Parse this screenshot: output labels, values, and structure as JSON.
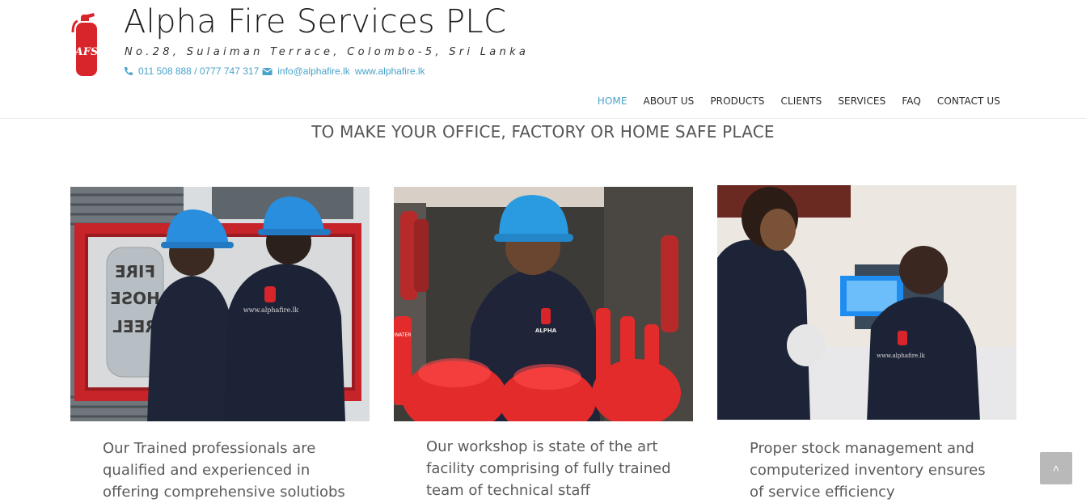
{
  "brand": {
    "title": "Alpha Fire Services PLC",
    "address": "No.28, Sulaiman Terrace, Colombo-5, Sri Lanka",
    "phone": "011 508 888 / 0777 747 317",
    "email": "info@alphafire.lk",
    "website": "www.alphafire.lk",
    "logo_text": "AFS"
  },
  "nav": {
    "items": [
      {
        "label": "HOME",
        "active": true
      },
      {
        "label": "ABOUT US"
      },
      {
        "label": "PRODUCTS"
      },
      {
        "label": "CLIENTS"
      },
      {
        "label": "SERVICES"
      },
      {
        "label": "FAQ"
      },
      {
        "label": "CONTACT US"
      }
    ]
  },
  "main": {
    "tagline": "TO MAKE YOUR OFFICE, FACTORY OR HOME SAFE PLACE",
    "cards": [
      {
        "caption_lines": [
          "Our Trained professionals are",
          "qualified and experienced in",
          "offering comprehensive solutiobs"
        ],
        "photo_texts": [
          "FIRE",
          "HOSE",
          "REEL",
          "www.alphafire.lk"
        ]
      },
      {
        "caption_lines": [
          "Our workshop is state of the art",
          "facility comprising of fully trained",
          "team of technical staff"
        ],
        "photo_texts": [
          "ALPHA",
          "WATER"
        ]
      },
      {
        "caption_lines": [
          "Proper stock management and",
          "computerized inventory ensures",
          "of service efficiency"
        ],
        "photo_texts": [
          "www.alphafire.lk"
        ]
      }
    ]
  },
  "scroll_top": {
    "icon": "chevron-up-icon",
    "glyph": "˄"
  },
  "colors": {
    "accent": "#4aa3c9",
    "brand_red": "#d8252b",
    "text": "#5b5b5b"
  }
}
